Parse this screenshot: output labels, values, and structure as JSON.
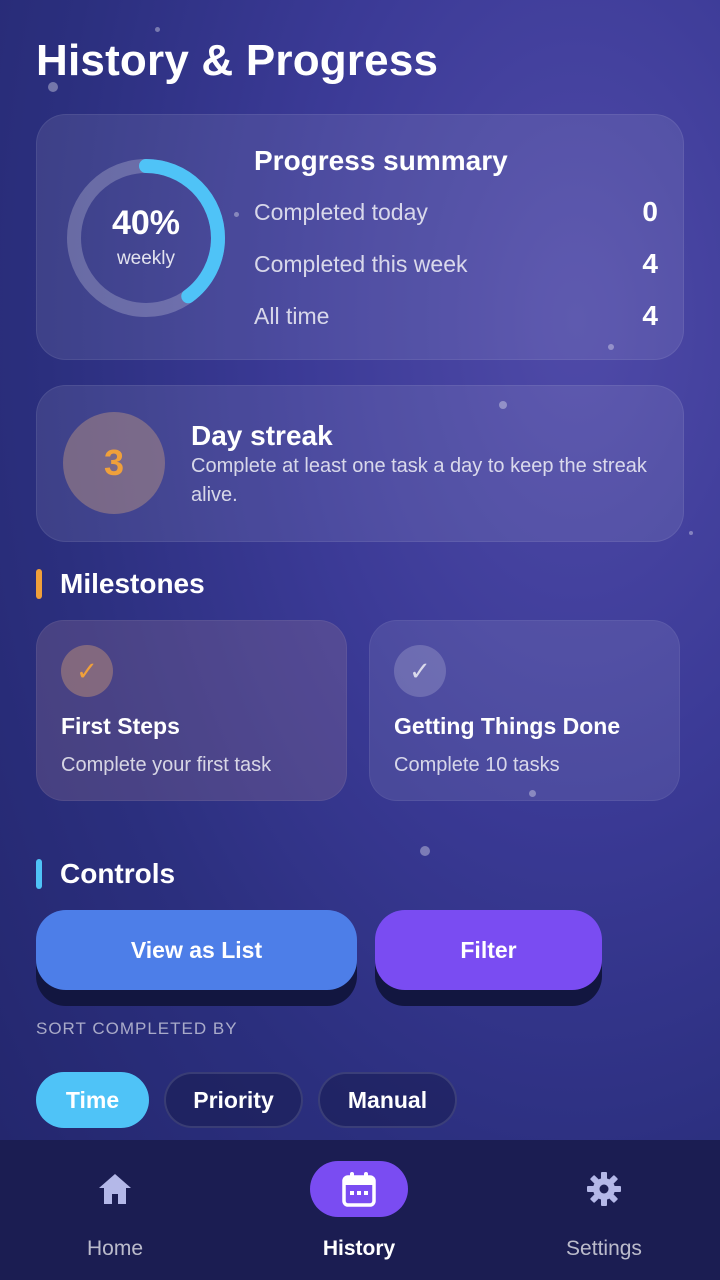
{
  "page": {
    "title": "History & Progress"
  },
  "summary": {
    "ring_value": "40%",
    "ring_caption": "weekly",
    "ring_fraction": 0.4,
    "title": "Progress summary",
    "stats": [
      {
        "label": "Completed today",
        "value": "0"
      },
      {
        "label": "Completed this week",
        "value": "4"
      },
      {
        "label": "All time",
        "value": "4"
      }
    ]
  },
  "streak": {
    "count": "3",
    "title": "Day streak",
    "description": "Complete at least one task a day to keep the streak alive."
  },
  "milestones": {
    "header": "Milestones",
    "items": [
      {
        "title": "First Steps",
        "description": "Complete your first task",
        "achieved": true
      },
      {
        "title": "Getting Things Done",
        "description": "Complete 10 tasks",
        "achieved": false
      }
    ]
  },
  "controls": {
    "header": "Controls",
    "view_list_label": "View as List",
    "filter_label": "Filter",
    "sort_label": "SORT COMPLETED BY",
    "sort_options": [
      "Time",
      "Priority",
      "Manual"
    ],
    "sort_selected": "Time"
  },
  "nav": {
    "items": [
      {
        "label": "Home",
        "icon": "home-icon"
      },
      {
        "label": "History",
        "icon": "calendar-icon"
      },
      {
        "label": "Settings",
        "icon": "gear-icon"
      }
    ],
    "active": "History"
  },
  "colors": {
    "accent_blue": "#4fc3f7",
    "accent_orange": "#f0a03a",
    "button_blue": "#4d7ee8",
    "button_purple": "#7a4cf2",
    "nav_bg": "#1b1d52"
  }
}
